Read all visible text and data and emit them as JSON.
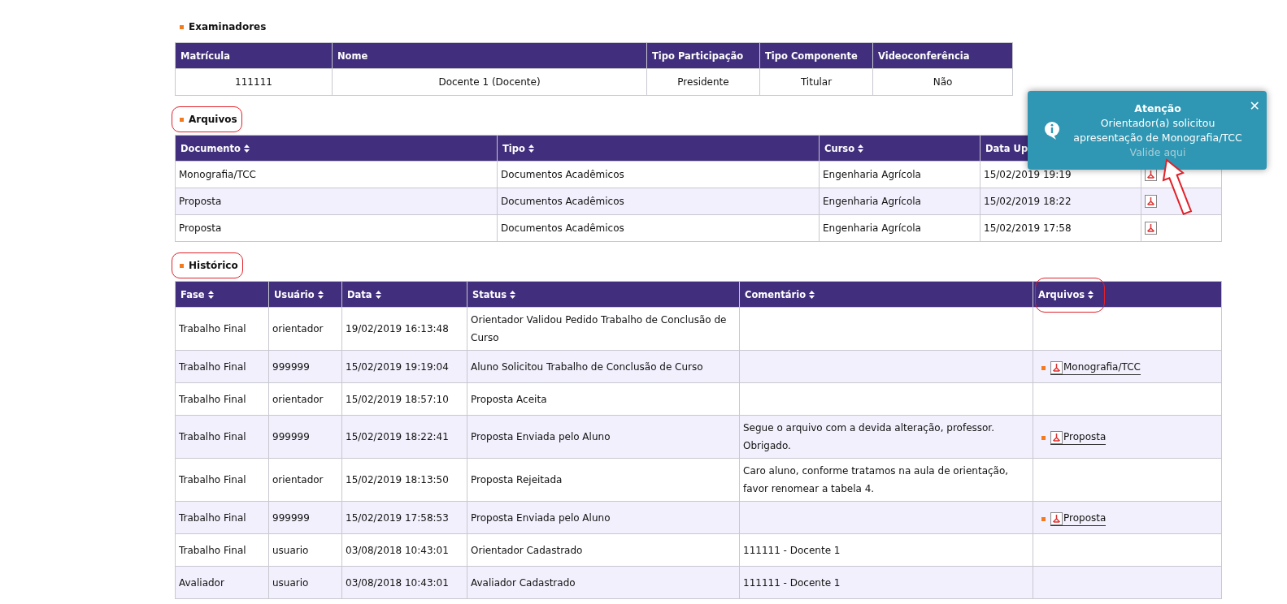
{
  "sections": [
    {
      "title": "Examinadores",
      "highlighted": false,
      "table": {
        "columns": [
          {
            "label": "Matrícula",
            "sortable": false,
            "highlighted": false
          },
          {
            "label": "Nome",
            "sortable": false,
            "highlighted": false
          },
          {
            "label": "Tipo Participação",
            "sortable": false,
            "highlighted": false
          },
          {
            "label": "Tipo Componente",
            "sortable": false,
            "highlighted": false
          },
          {
            "label": "Videoconferência",
            "sortable": false,
            "highlighted": false
          }
        ],
        "rows": [
          [
            "111111",
            "Docente 1 (Docente)",
            "Presidente",
            "Titular",
            "Não"
          ]
        ]
      }
    },
    {
      "title": "Arquivos",
      "highlighted": true,
      "table": {
        "columns": [
          {
            "label": "Documento",
            "sortable": true,
            "highlighted": false
          },
          {
            "label": "Tipo",
            "sortable": true,
            "highlighted": false
          },
          {
            "label": "Curso",
            "sortable": true,
            "highlighted": false
          },
          {
            "label": "Data Up",
            "highlighted": false
          }
        ],
        "rows": [
          [
            "Monografia/TCC",
            "Documentos Acadêmicos",
            "Engenharia Agrícola",
            "15/02/2019 19:19",
            {
              "kind": "pdf"
            }
          ],
          [
            "Proposta",
            "Documentos Acadêmicos",
            "Engenharia Agrícola",
            "15/02/2019 18:22",
            {
              "kind": "pdf"
            }
          ],
          [
            "Proposta",
            "Documentos Acadêmicos",
            "Engenharia Agrícola",
            "15/02/2019 17:58",
            {
              "kind": "pdf"
            }
          ]
        ]
      }
    },
    {
      "title": "Histórico",
      "highlighted": true,
      "table": {
        "columns": [
          {
            "label": "Fase",
            "sortable": true,
            "highlighted": false
          },
          {
            "label": "Usuário",
            "sortable": true,
            "highlighted": false
          },
          {
            "label": "Data",
            "sortable": true,
            "highlighted": false
          },
          {
            "label": "Status",
            "sortable": true,
            "highlighted": false
          },
          {
            "label": "Comentário",
            "sortable": true,
            "highlighted": false
          },
          {
            "label": "Arquivos",
            "sortable": true,
            "highlighted": true
          }
        ],
        "rows": [
          [
            "Trabalho Final",
            "orientador",
            "19/02/2019 16:13:48",
            "Orientador Validou Pedido Trabalho de Conclusão de Curso",
            null,
            null
          ],
          [
            "Trabalho Final",
            "999999",
            "15/02/2019 19:19:04",
            "Aluno Solicitou Trabalho de Conclusão de Curso",
            null,
            {
              "kind": "file-link",
              "label": "Monografia/TCC"
            }
          ],
          [
            "Trabalho Final",
            "orientador",
            "15/02/2019 18:57:10",
            "Proposta Aceita",
            null,
            null
          ],
          [
            "Trabalho Final",
            "999999",
            "15/02/2019 18:22:41",
            "Proposta Enviada pelo Aluno",
            "Segue o arquivo com a devida alteração, professor. Obrigado.",
            {
              "kind": "file-link",
              "label": "Proposta"
            }
          ],
          [
            "Trabalho Final",
            "orientador",
            "15/02/2019 18:13:50",
            "Proposta Rejeitada",
            "Caro aluno, conforme tratamos na aula de orientação, favor renomear a tabela 4.",
            null
          ],
          [
            "Trabalho Final",
            "999999",
            "15/02/2019 17:58:53",
            "Proposta Enviada pelo Aluno",
            null,
            {
              "kind": "file-link",
              "label": "Proposta"
            }
          ],
          [
            "Trabalho Final",
            "usuario",
            "03/08/2018 10:43:01",
            "Orientador Cadastrado",
            "111111 - Docente 1",
            null
          ],
          [
            "Avaliador",
            "usuario",
            "03/08/2018 10:43:01",
            "Avaliador Cadastrado",
            "111111 - Docente 1",
            null
          ]
        ]
      }
    }
  ],
  "toast": {
    "title": "Atenção",
    "message": "Orientador(a) solicitou apresentação de Monografia/TCC",
    "link": "Valide aqui",
    "close": "✕",
    "pointer": true
  }
}
